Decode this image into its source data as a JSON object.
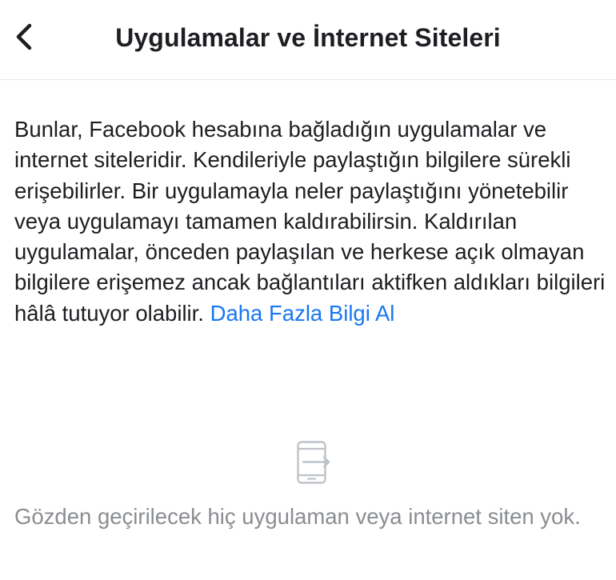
{
  "header": {
    "title": "Uygulamalar ve İnternet Siteleri"
  },
  "description": {
    "text": "Bunlar, Facebook hesabına bağladığın uygulamalar ve internet siteleridir. Kendileriyle paylaştığın bilgilere sürekli erişebilirler. Bir uygulamayla neler paylaştığını yönetebilir veya uygulamayı tamamen kaldırabilirsin. Kaldırılan uygulamalar, önceden paylaşılan ve herkese açık olmayan bilgilere erişemez ancak bağlantıları aktifken aldıkları bilgileri hâlâ tutuyor olabilir.",
    "link_label": "Daha Fazla Bilgi Al"
  },
  "empty_state": {
    "icon": "phone-login-icon",
    "message": "Gözden geçirilecek hiç uygulaman veya internet siten yok."
  },
  "colors": {
    "text": "#1c1e21",
    "link": "#1877f2",
    "muted": "#8a8d91",
    "icon": "#bec3c9",
    "divider": "#e9eaec"
  }
}
